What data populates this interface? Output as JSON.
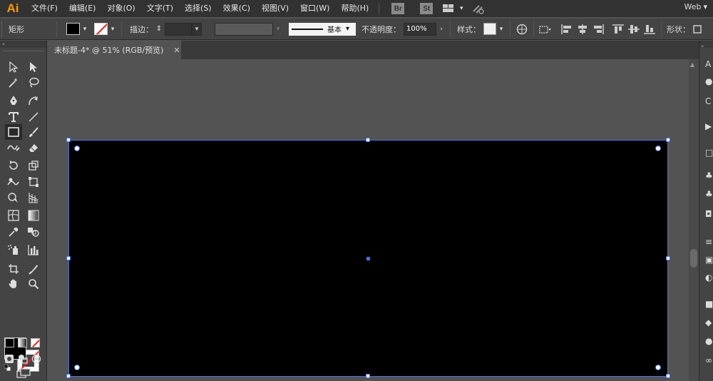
{
  "app": {
    "logo": "Ai",
    "workspace": "Web"
  },
  "menu": [
    "文件(F)",
    "编辑(E)",
    "对象(O)",
    "文字(T)",
    "选择(S)",
    "效果(C)",
    "视图(V)",
    "窗口(W)",
    "帮助(H)"
  ],
  "bridge_label": "Br",
  "stock_label": "St",
  "control": {
    "shape_label": "矩形",
    "stroke_label": "描边：",
    "stroke_profile": "基本",
    "opacity_label": "不透明度：",
    "opacity_value": "100%",
    "style_label": "样式：",
    "shape_menu_label": "形状："
  },
  "document": {
    "tab_title": "未标题-4* @ 51% (RGB/预览)",
    "tab_close": "✕"
  },
  "colors": {
    "accent": "#ff9a00",
    "selection": "#4a6fe0",
    "fill": "#000000",
    "stroke_none": "#e2201b"
  },
  "icons": {
    "double_arrow": "«",
    "double_arrow_right": "»",
    "chevron": "⌄",
    "swap": "⇄"
  }
}
